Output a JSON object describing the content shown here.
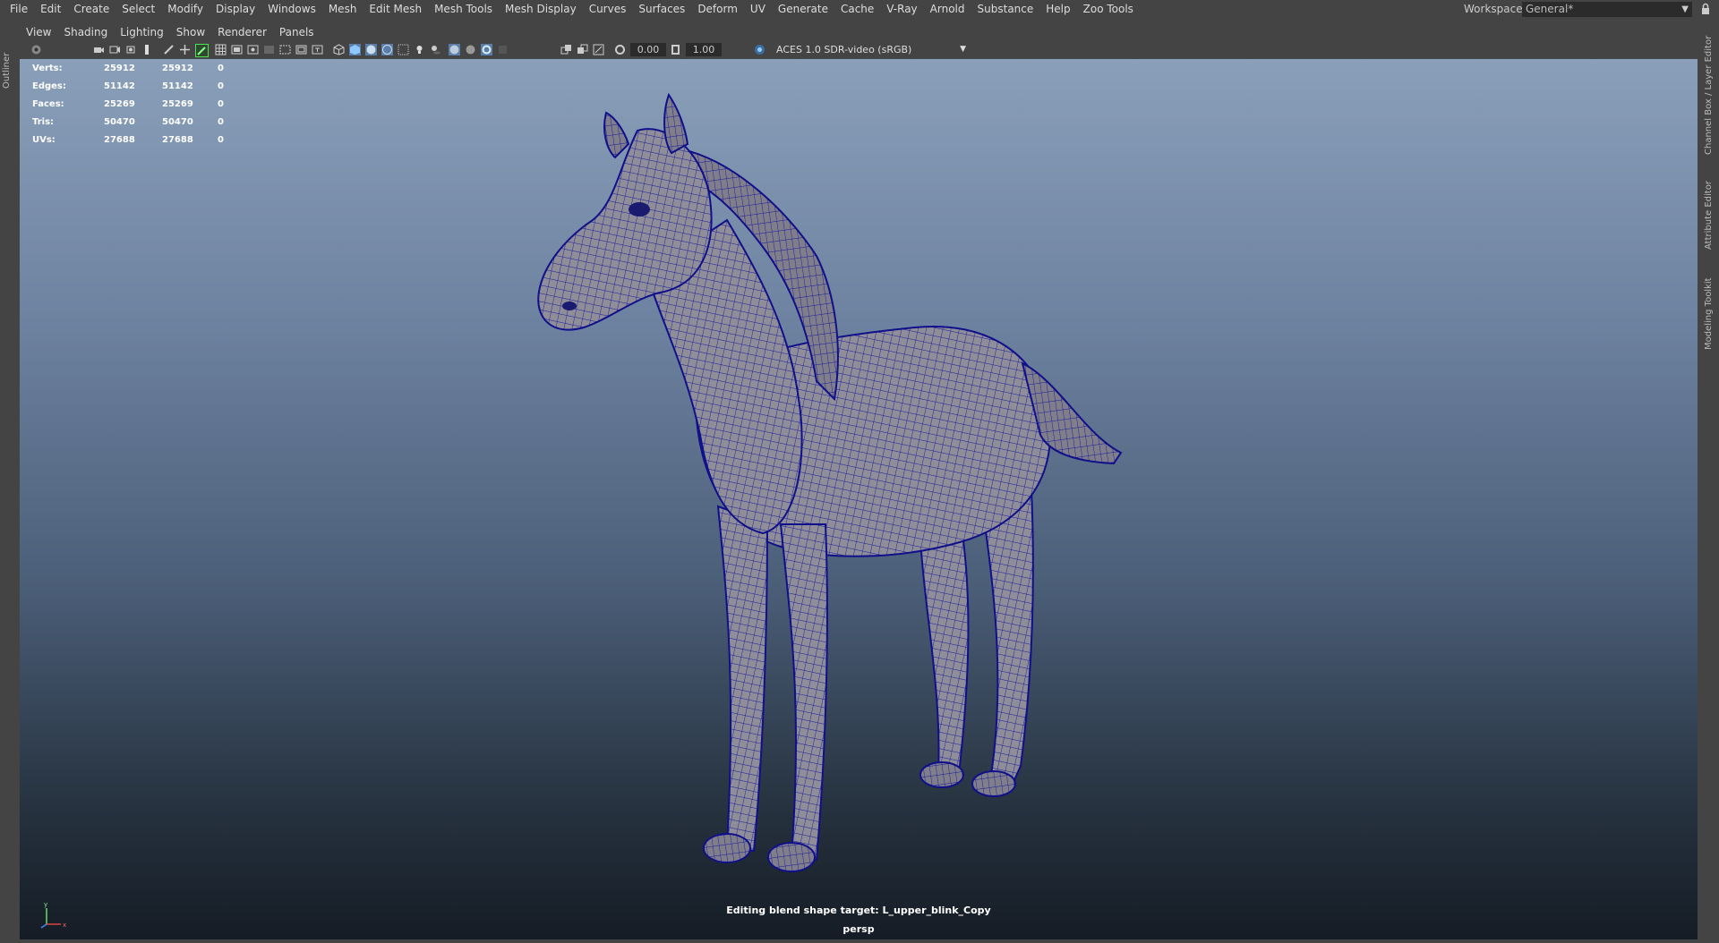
{
  "menubar": {
    "items": [
      "File",
      "Edit",
      "Create",
      "Select",
      "Modify",
      "Display",
      "Windows",
      "Mesh",
      "Edit Mesh",
      "Mesh Tools",
      "Mesh Display",
      "Curves",
      "Surfaces",
      "Deform",
      "UV",
      "Generate",
      "Cache",
      "V-Ray",
      "Arnold",
      "Substance",
      "Help",
      "Zoo Tools"
    ],
    "workspace_label": "Workspace:",
    "workspace_value": "General*"
  },
  "side_tabs": {
    "left": "Outliner",
    "right": [
      "Channel Box / Layer Editor",
      "Attribute Editor",
      "Modeling Toolkit"
    ]
  },
  "panel": {
    "menus": [
      "View",
      "Shading",
      "Lighting",
      "Show",
      "Renderer",
      "Panels"
    ],
    "exposure": "0.00",
    "gamma": "1.00",
    "colorspace": "ACES 1.0 SDR-video (sRGB)"
  },
  "hud": {
    "rows": [
      {
        "label": "Verts:",
        "v1": "25912",
        "v2": "25912",
        "v3": "0"
      },
      {
        "label": "Edges:",
        "v1": "51142",
        "v2": "51142",
        "v3": "0"
      },
      {
        "label": "Faces:",
        "v1": "25269",
        "v2": "25269",
        "v3": "0"
      },
      {
        "label": "Tris:",
        "v1": "50470",
        "v2": "50470",
        "v3": "0"
      },
      {
        "label": "UVs:",
        "v1": "27688",
        "v2": "27688",
        "v3": "0"
      }
    ],
    "message": "Editing blend shape target: L_upper_blink_Copy",
    "camera": "persp"
  },
  "colors": {
    "ui_bg": "#444444",
    "field_bg": "#2b2b2b",
    "wire": "#1a1aa0",
    "mesh": "#8e8d98"
  }
}
